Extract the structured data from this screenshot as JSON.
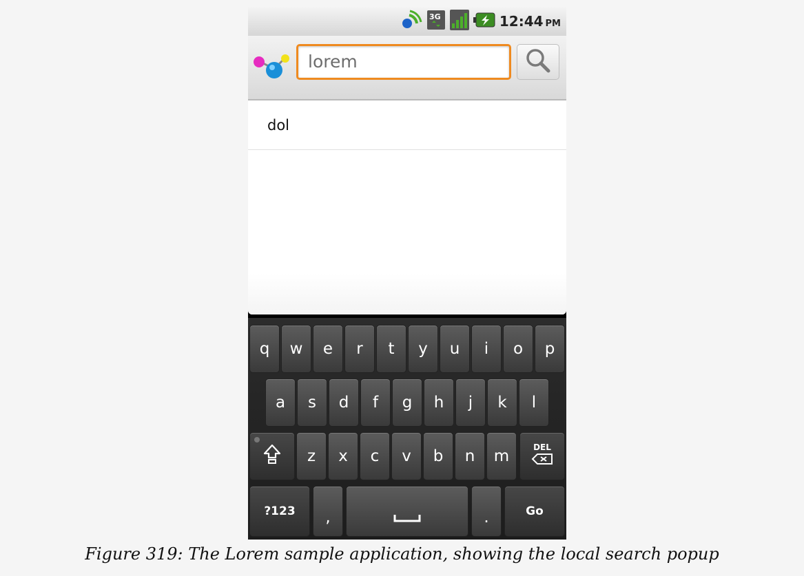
{
  "status_bar": {
    "time": "12:44",
    "ampm": "PM",
    "icons": [
      "sync-icon",
      "3g-data-icon",
      "signal-icon",
      "battery-charging-icon"
    ]
  },
  "search": {
    "query": "lorem",
    "button_icon": "magnifier-icon",
    "accent_color": "#ef8a1f"
  },
  "suggestions": [
    "dol"
  ],
  "keyboard": {
    "row1": [
      "q",
      "w",
      "e",
      "r",
      "t",
      "y",
      "u",
      "i",
      "o",
      "p"
    ],
    "row2": [
      "a",
      "s",
      "d",
      "f",
      "g",
      "h",
      "j",
      "k",
      "l"
    ],
    "row3": [
      "z",
      "x",
      "c",
      "v",
      "b",
      "n",
      "m"
    ],
    "shift_icon": "shift-icon",
    "delete_label": "DEL",
    "symbols_label": "?123",
    "comma_label": ",",
    "period_label": ".",
    "go_label": "Go"
  },
  "caption": "Figure 319: The Lorem sample application, showing the local search popup"
}
